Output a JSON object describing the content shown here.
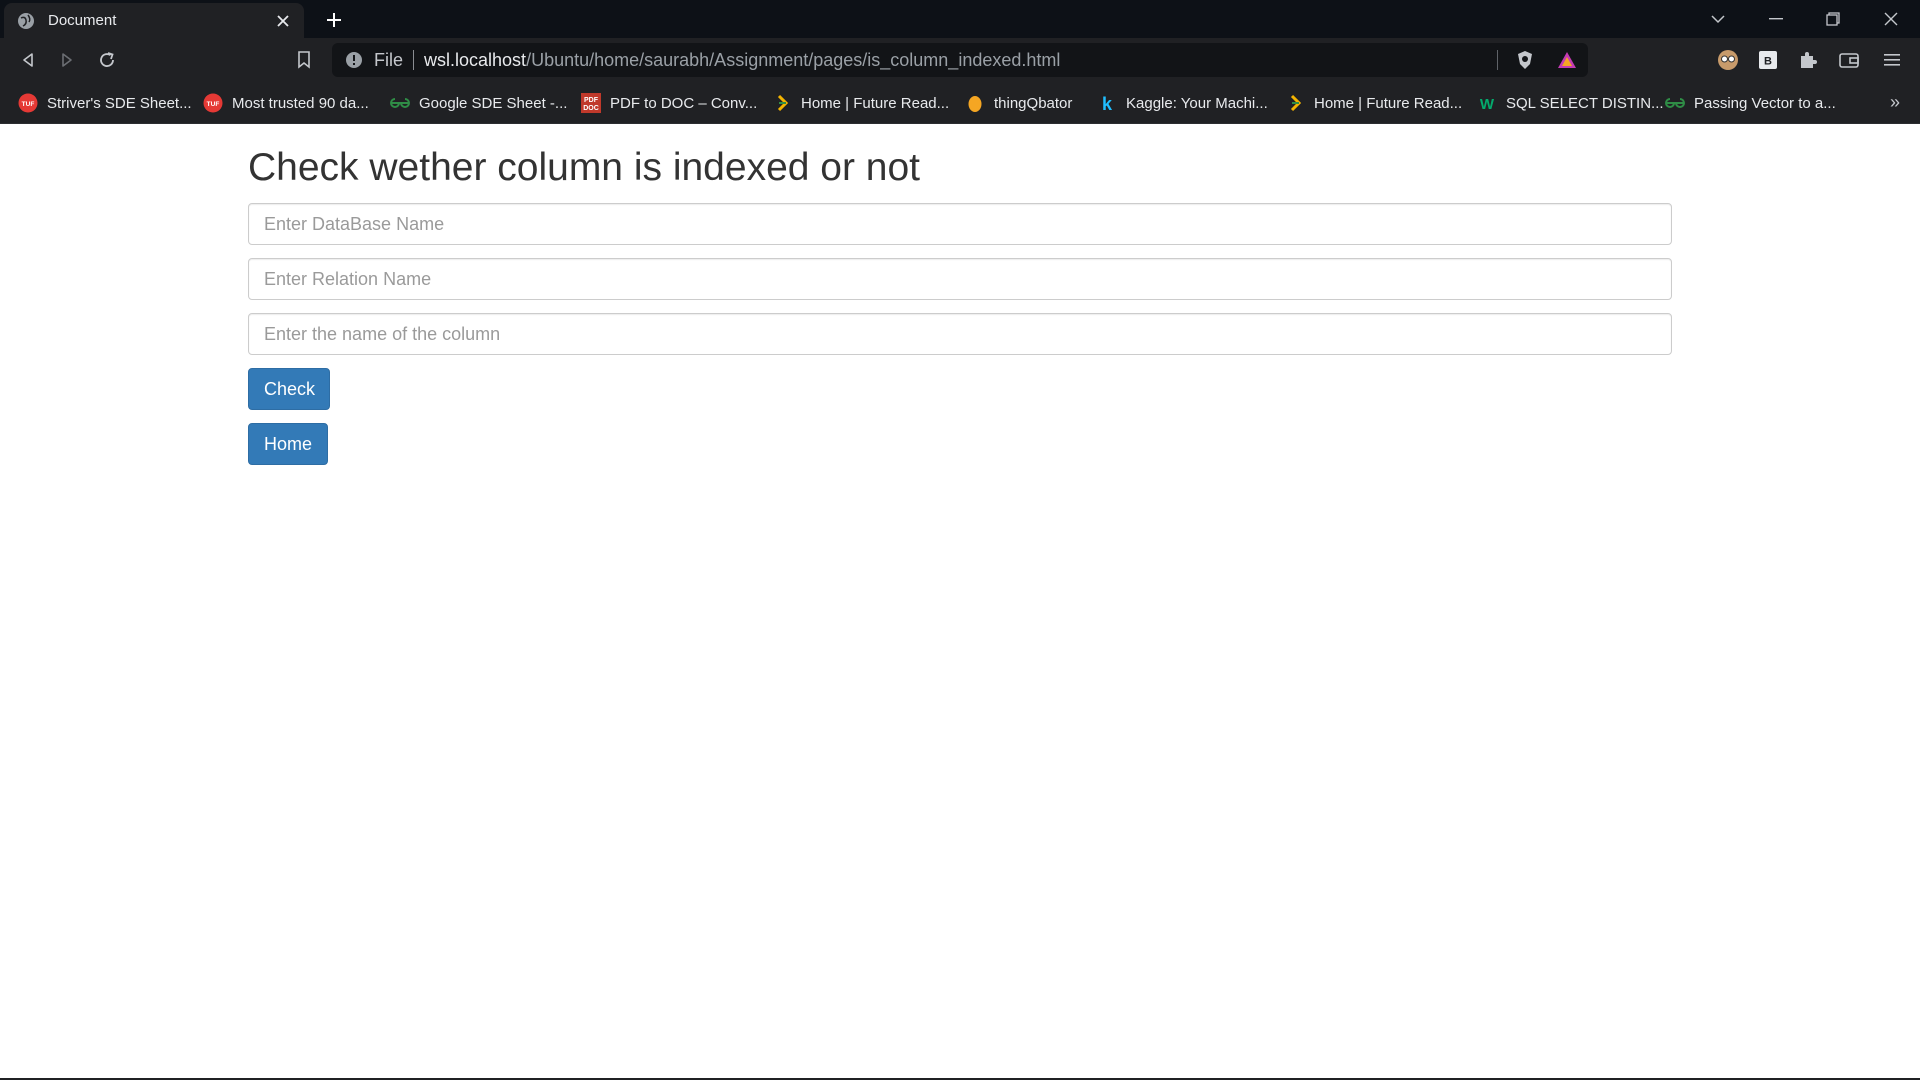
{
  "browser": {
    "tab_title": "Document",
    "address": {
      "scheme": "File",
      "host": "wsl.localhost",
      "path": "/Ubuntu/home/saurabh/Assignment/pages/is_column_indexed.html"
    },
    "bookmarks": [
      {
        "label": "Striver's SDE Sheet...",
        "icon": "tuf-icon",
        "color": "#e53935",
        "badge": "TUF"
      },
      {
        "label": "Most trusted 90 da...",
        "icon": "tuf-icon",
        "color": "#e53935",
        "badge": "TUF"
      },
      {
        "label": "Google SDE Sheet -...",
        "icon": "gfg-icon",
        "color": "#2f8d46",
        "badge": "∞"
      },
      {
        "label": "PDF to DOC – Conv...",
        "icon": "pdf-doc-icon",
        "color": "#c0392b",
        "badge": "PDF"
      },
      {
        "label": "Home | Future Read...",
        "icon": "future-ready-icon",
        "color": "#f4b400",
        "badge": "›"
      },
      {
        "label": "thingQbator",
        "icon": "thingqbator-icon",
        "color": "#f5a623",
        "badge": "●"
      },
      {
        "label": "Kaggle: Your Machi...",
        "icon": "kaggle-icon",
        "color": "#20beff",
        "badge": "k"
      },
      {
        "label": "Home | Future Read...",
        "icon": "future-ready-icon",
        "color": "#f4b400",
        "badge": "›"
      },
      {
        "label": "SQL SELECT DISTIN...",
        "icon": "w3schools-icon",
        "color": "#04aa6d",
        "badge": "W"
      },
      {
        "label": "Passing Vector to a...",
        "icon": "gfg-icon",
        "color": "#2f8d46",
        "badge": "∞"
      }
    ],
    "bookmarks_more": "»"
  },
  "page": {
    "title": "Check wether column is indexed or not",
    "fields": {
      "database_placeholder": "Enter DataBase Name",
      "relation_placeholder": "Enter Relation Name",
      "column_placeholder": "Enter the name of the column"
    },
    "check_label": "Check",
    "home_label": "Home"
  },
  "colors": {
    "primary_button": "#337ab7",
    "chrome_dark": "#202124",
    "tabstrip": "#0d1117"
  }
}
